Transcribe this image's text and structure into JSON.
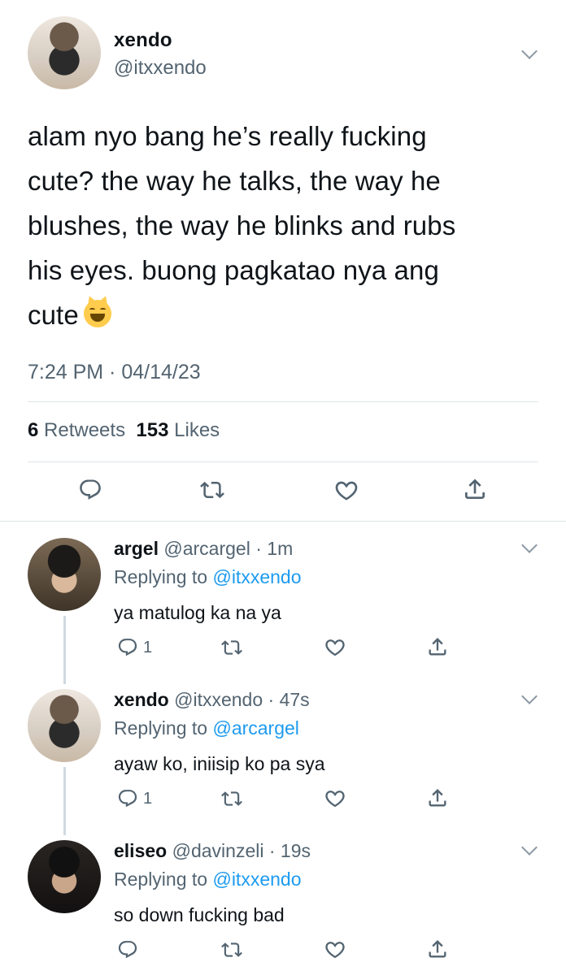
{
  "main_tweet": {
    "author_name": "xendo",
    "author_handle": "@itxxendo",
    "text_lines": [
      "alam nyo bang he’s really fucking",
      "cute? the way he talks, the way he",
      "blushes, the way he blinks and rubs",
      "his eyes. buong pagkatao nya ang",
      "cute"
    ],
    "timestamp": "7:24 PM · 04/14/23",
    "retweets_count": "6",
    "retweets_label": "Retweets",
    "likes_count": "153",
    "likes_label": "Likes",
    "emoji": "smiling-cat-face-with-open-mouth"
  },
  "replies": [
    {
      "name": "argel",
      "handle": "@arcargel",
      "time": "1m",
      "replying_prefix": "Replying to",
      "replying_to": "@itxxendo",
      "text": "ya matulog ka na ya",
      "reply_count": "1"
    },
    {
      "name": "xendo",
      "handle": "@itxxendo",
      "time": "47s",
      "replying_prefix": "Replying to",
      "replying_to": "@arcargel",
      "text": "ayaw ko, iniisip ko pa sya",
      "reply_count": "1"
    },
    {
      "name": "eliseo",
      "handle": "@davinzeli",
      "time": "19s",
      "replying_prefix": "Replying to",
      "replying_to": "@itxxendo",
      "text": "so down fucking bad",
      "reply_count": ""
    }
  ],
  "icons": {
    "reply": "reply-icon",
    "retweet": "retweet-icon",
    "like": "heart-icon",
    "share": "share-icon",
    "more": "chevron-down-icon"
  },
  "colors": {
    "text": "#0f1419",
    "secondary": "#536471",
    "accent": "#1d9bf0",
    "divider": "#e1e6ea"
  }
}
